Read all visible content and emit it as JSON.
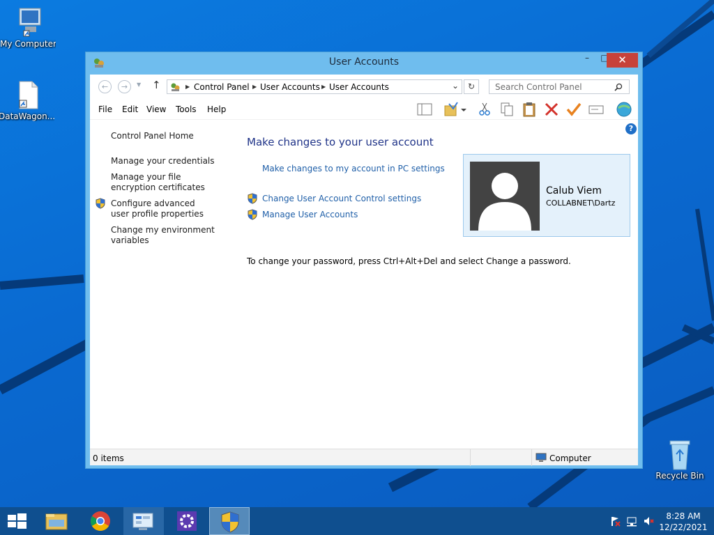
{
  "desktop": {
    "icons": [
      {
        "label": "My Computer",
        "icon": "computer-icon"
      },
      {
        "label": "DataWagon...",
        "icon": "document-shortcut-icon"
      },
      {
        "label": "Recycle Bin",
        "icon": "recycle-bin-icon"
      }
    ]
  },
  "window": {
    "title": "User Accounts",
    "controls": {
      "minimize": "–",
      "maximize": "□",
      "close": "✕"
    },
    "breadcrumb": [
      "Control Panel",
      "User Accounts",
      "User Accounts"
    ],
    "search_placeholder": "Search Control Panel",
    "menu": [
      "File",
      "Edit",
      "View",
      "Tools",
      "Help"
    ],
    "sidebar": {
      "home": "Control Panel Home",
      "links": [
        "Manage your credentials",
        "Manage your file encryption certificates",
        "Configure advanced user profile properties",
        "Change my environment variables"
      ]
    },
    "main": {
      "heading": "Make changes to your user account",
      "pc_settings_link": "Make changes to my account in PC settings",
      "uac_link": "Change User Account Control settings",
      "manage_link": "Manage User Accounts",
      "hint": "To change your password, press Ctrl+Alt+Del and select Change a password."
    },
    "user": {
      "name": "Calub Viem",
      "domain": "COLLABNET\\Dartz"
    },
    "status": {
      "items": "0 items",
      "location": "Computer"
    }
  },
  "taskbar": {
    "time": "8:28 AM",
    "date": "12/22/2021"
  },
  "colors": {
    "accent": "#1f5fa8",
    "heading": "#1e3287",
    "close_button": "#c7423a",
    "titlebar": "#6fbdee"
  }
}
